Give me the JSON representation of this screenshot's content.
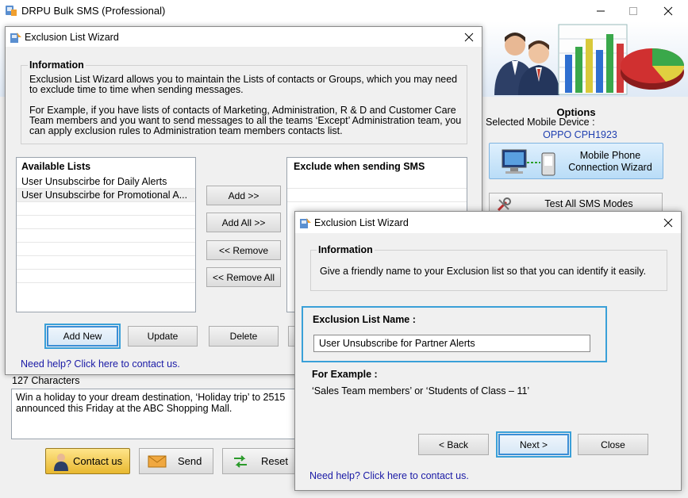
{
  "main_window": {
    "title": "DRPU Bulk SMS (Professional)",
    "options": {
      "heading": "Options",
      "device_label": "Selected Mobile Device :",
      "device_value": "OPPO CPH1923",
      "connection_wizard_label": "Mobile Phone Connection  Wizard",
      "test_modes_label": "Test All SMS Modes"
    },
    "characters_label": "127 Characters",
    "message_text": "Win a holiday to your dream destination, ‘Holiday trip’ to 2515 announced this Friday at the ABC Shopping Mall.",
    "buttons": {
      "contact_us": "Contact us",
      "send": "Send",
      "reset": "Reset"
    }
  },
  "wizard1": {
    "title": "Exclusion List Wizard",
    "info_heading": "Information",
    "info_text_1": "Exclusion List Wizard allows you to maintain the Lists of contacts or Groups, which you may need to exclude time to time when sending messages.",
    "info_text_2": "For Example, if you have lists of contacts of Marketing, Administration, R & D and Customer Care Team members and you want to send messages to all the teams ‘Except’ Administration team, you can apply exclusion rules to Administration team members contacts list.",
    "available_heading": "Available Lists",
    "available_items": [
      "User Unsubscirbe for Daily Alerts",
      "User Unsubscirbe for Promotional A..."
    ],
    "exclude_heading": "Exclude when sending SMS",
    "add_label": "Add >>",
    "add_all_label": "Add All >>",
    "remove_label": "<< Remove",
    "remove_all_label": "<< Remove All",
    "add_new_label": "Add New",
    "update_label": "Update",
    "delete_label": "Delete",
    "help_link": "Need help? Click here to contact us."
  },
  "wizard2": {
    "title": "Exclusion List Wizard",
    "info_heading": "Information",
    "info_text": "Give a friendly name to your Exclusion list so that you can identify it easily.",
    "name_label": "Exclusion List Name :",
    "name_value": "User Unsubscribe for Partner Alerts",
    "example_label": "For Example :",
    "example_text": "‘Sales Team members’ or ‘Students of Class – 11’",
    "back_label": "< Back",
    "next_label": "Next >",
    "close_label": "Close",
    "help_link": "Need help? Click here to contact us."
  },
  "colors": {
    "accent": "#3aa0d8",
    "link": "#1a1aa6",
    "device": "#1f3fb0"
  }
}
